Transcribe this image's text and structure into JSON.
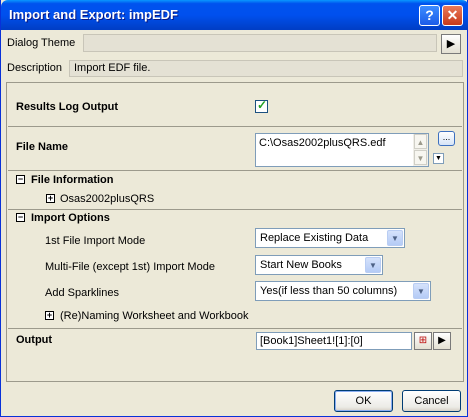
{
  "window": {
    "title": "Import and Export: impEDF"
  },
  "titlebar": {
    "help_glyph": "?",
    "close_glyph": "✕"
  },
  "dialog_theme": {
    "label": "Dialog Theme",
    "value": "",
    "button_glyph": "▶"
  },
  "description": {
    "label": "Description",
    "value": "Import EDF file."
  },
  "results_log": {
    "label": "Results Log Output",
    "checked": true,
    "check_glyph": "✓"
  },
  "file_name": {
    "label": "File Name",
    "value": "C:\\Osas2002plusQRS.edf",
    "browse_label": "...",
    "scroll_up": "▲",
    "scroll_down": "▼",
    "dropdown_glyph": "▼"
  },
  "file_information": {
    "collapse_glyph": "−",
    "label": "File Information",
    "child": {
      "expand_glyph": "+",
      "label": "Osas2002plusQRS"
    }
  },
  "import_options": {
    "collapse_glyph": "−",
    "label": "Import Options",
    "first_file_mode": {
      "label": "1st File Import Mode",
      "value": "Replace Existing Data"
    },
    "multi_file_mode": {
      "label": "Multi-File (except 1st) Import Mode",
      "value": "Start New Books"
    },
    "sparklines": {
      "label": "Add Sparklines",
      "value": "Yes(if less than 50 columns)"
    },
    "renaming": {
      "expand_glyph": "+",
      "label": "(Re)Naming Worksheet and Workbook"
    },
    "dropdown_glyph": "▼"
  },
  "output": {
    "label": "Output",
    "value": "[Book1]Sheet1![1]:[0]",
    "picker_glyph": "⊞",
    "arrow_glyph": "▶"
  },
  "buttons": {
    "ok": "OK",
    "cancel": "Cancel"
  }
}
